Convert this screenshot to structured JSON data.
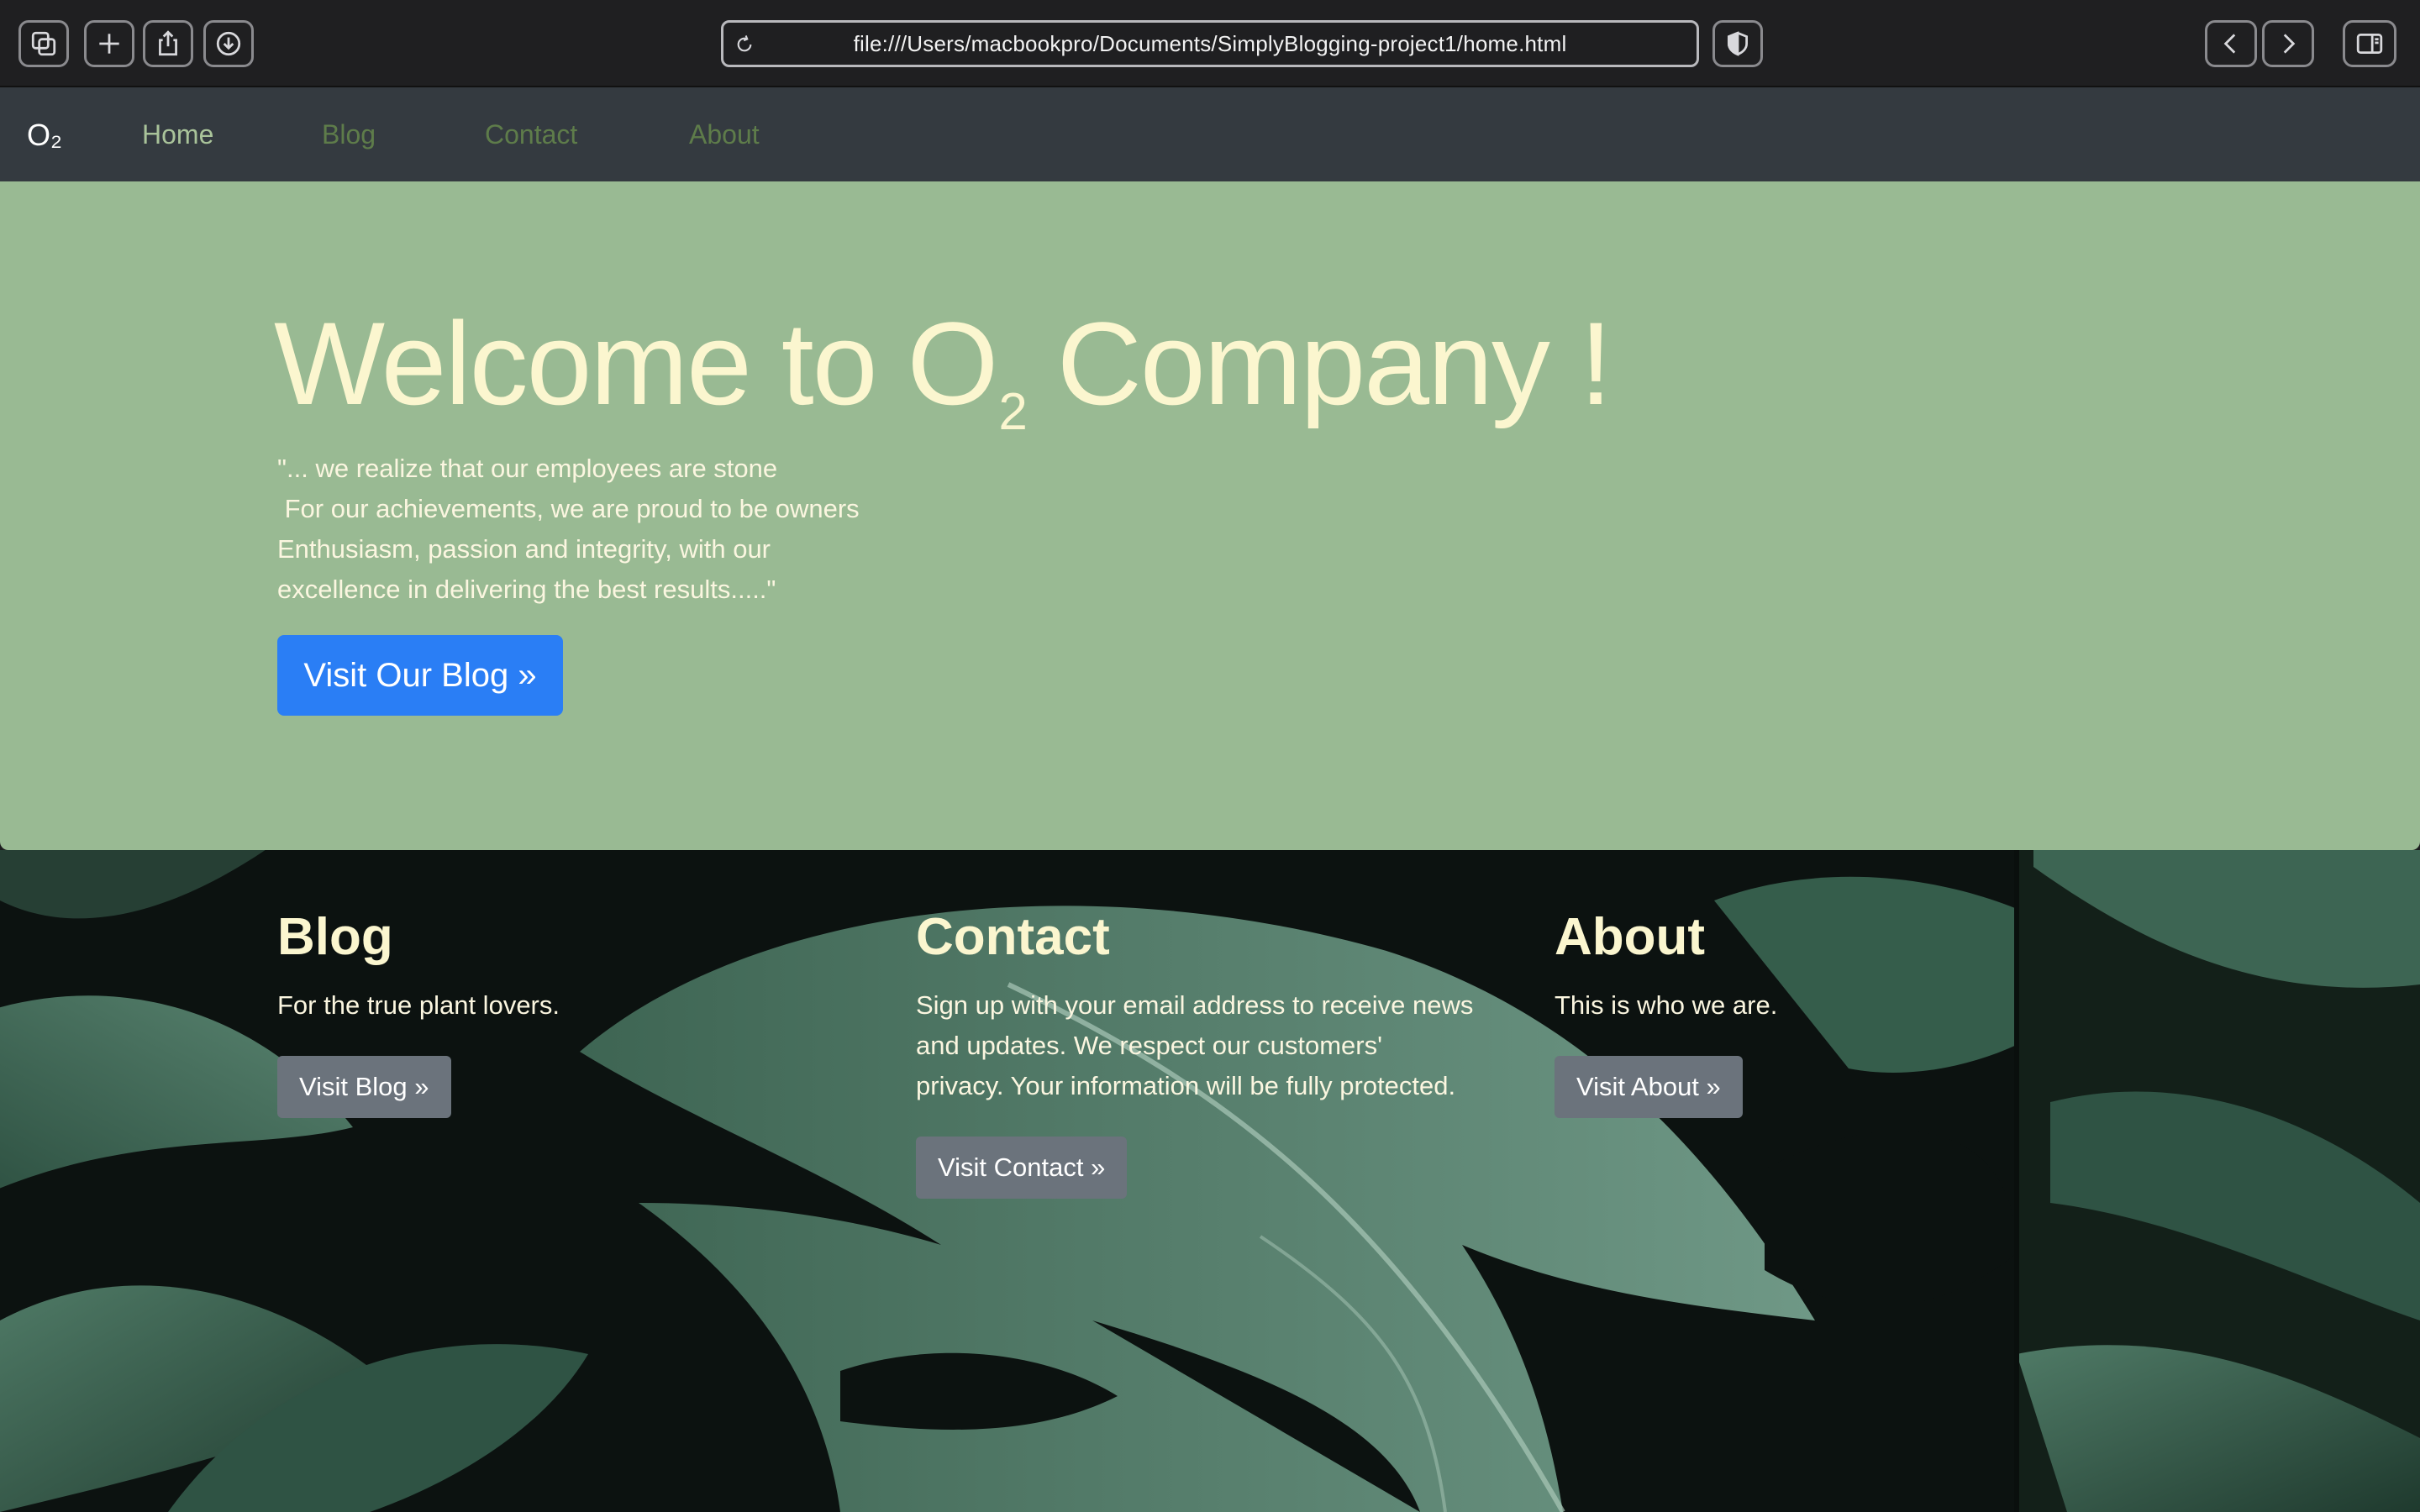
{
  "browser": {
    "url": "file:///Users/macbookpro/Documents/SimplyBlogging-project1/home.html"
  },
  "navbar": {
    "brand": "O₂",
    "links": [
      {
        "label": "Home",
        "active": true
      },
      {
        "label": "Blog",
        "active": false
      },
      {
        "label": "Contact",
        "active": false
      },
      {
        "label": "About",
        "active": false
      }
    ]
  },
  "hero": {
    "title_main": "Welcome to O",
    "title_sub": "2",
    "title_end": " Company !",
    "quote_lines": [
      "\"... we realize that our employees are stone",
      " For our achievements, we are proud to be owners",
      "Enthusiasm, passion and integrity, with our",
      "excellence in delivering the best results.....\""
    ],
    "button_label": "Visit Our Blog »"
  },
  "cards": [
    {
      "heading": "Blog",
      "text_lines": [
        "For the true plant lovers."
      ],
      "button_label": "Visit Blog »"
    },
    {
      "heading": "Contact",
      "text_lines": [
        "Sign up with your email address to receive news",
        "and updates. We respect our customers'",
        "privacy. Your information will be fully protected."
      ],
      "button_label": "Visit Contact »"
    },
    {
      "heading": "About",
      "text_lines": [
        "This is who we are."
      ],
      "button_label": "Visit About »"
    }
  ],
  "colors": {
    "navbar_bg": "#343a40",
    "hero_bg": "#99ba93",
    "hero_text": "#fbf6cf",
    "primary_button": "#2a7ef5",
    "secondary_button": "#6b737c",
    "nav_active": "#a9c39a",
    "nav_inactive": "#5e7c4a"
  }
}
